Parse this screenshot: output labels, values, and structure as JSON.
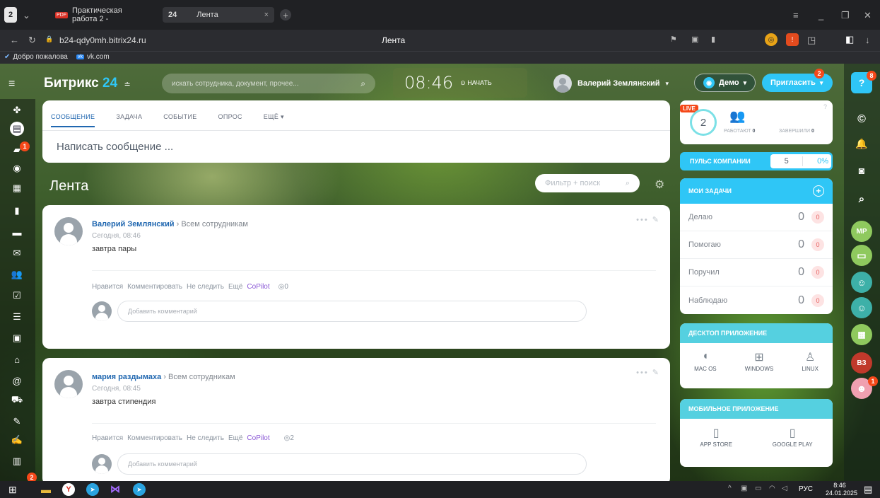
{
  "browser": {
    "tab_count": "2",
    "tab1_label": "Практическая работа 2 -",
    "tab2_prefix": "24",
    "tab2_label": "Лента",
    "url": "b24-qdy0mh.bitrix24.ru",
    "page_title": "Лента",
    "bookmarks": [
      "Добро пожалова",
      "vk.com"
    ]
  },
  "header": {
    "brand": "Битрикс",
    "brand_num": "24",
    "search_placeholder": "искать сотрудника, документ, прочее...",
    "time": "08:46",
    "start_label": "НАЧАТЬ",
    "user_name": "Валерий Землянский",
    "demo_label": "Демо",
    "invite_label": "Пригласить",
    "invite_badge": "2",
    "notif_badge": "8"
  },
  "sidebar": {
    "badges": {
      "chat": "1",
      "bottom": "2"
    }
  },
  "composer": {
    "tabs": [
      "СООБЩЕНИЕ",
      "ЗАДАЧА",
      "СОБЫТИЕ",
      "ОПРОС",
      "ЕЩЁ"
    ],
    "placeholder": "Написать сообщение ..."
  },
  "feed": {
    "title": "Лента",
    "filter_placeholder": "Фильтр + поиск",
    "actions": {
      "like": "Нравится",
      "comment": "Комментировать",
      "unfollow": "Не следить",
      "more": "Ещё",
      "copilot": "CoPilot"
    },
    "comment_placeholder": "Добавить комментарий",
    "posts": [
      {
        "author": "Валерий Землянский",
        "to": "Всем сотрудникам",
        "date": "Сегодня, 08:46",
        "text": "завтра пары",
        "views": "0"
      },
      {
        "author": "мария раздымаха",
        "to": "Всем сотрудникам",
        "date": "Сегодня, 08:45",
        "text": "завтра стипендия",
        "views": "2"
      }
    ]
  },
  "widgets": {
    "live": "LIVE",
    "count": "2",
    "working_label": "РАБОТАЮТ",
    "working_value": "0",
    "done_label": "ЗАВЕРШИЛИ",
    "done_value": "0",
    "pulse_label": "ПУЛЬС КОМПАНИИ",
    "pulse_value": "5",
    "pulse_percent": "0%",
    "tasks_title": "МОИ ЗАДАЧИ",
    "tasks": [
      {
        "label": "Делаю",
        "value": "0",
        "badge": "0"
      },
      {
        "label": "Помогаю",
        "value": "0",
        "badge": "0"
      },
      {
        "label": "Поручил",
        "value": "0",
        "badge": "0"
      },
      {
        "label": "Наблюдаю",
        "value": "0",
        "badge": "0"
      }
    ],
    "desktop_title": "ДЕСКТОП ПРИЛОЖЕНИЕ",
    "desktop_apps": [
      "MAC OS",
      "WINDOWS",
      "LINUX"
    ],
    "mobile_title": "МОБИЛЬНОЕ ПРИЛОЖЕНИЕ",
    "mobile_apps": [
      "APP STORE",
      "GOOGLE PLAY"
    ]
  },
  "rail": {
    "mp": "MP",
    "b3": "ВЗ",
    "b3_badge": "1"
  },
  "taskbar": {
    "lang": "РУС",
    "time": "8:46",
    "date": "24.01.2025"
  }
}
